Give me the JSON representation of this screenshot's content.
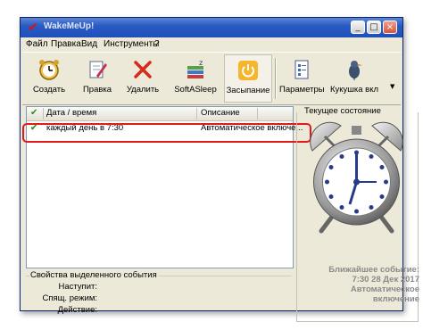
{
  "window": {
    "title": "WakeMeUp!"
  },
  "titlebar_buttons": {
    "minimize": "_",
    "maximize": "□",
    "close": "×"
  },
  "menu": [
    {
      "label": "Файл"
    },
    {
      "label": "Правка"
    },
    {
      "label": "Вид"
    },
    {
      "label": "Инструменты"
    },
    {
      "label": "?"
    }
  ],
  "toolbar": {
    "create": "Создать",
    "edit": "Правка",
    "delete": "Удалить",
    "softasleep": "SoftASleep",
    "sleep": "Засыпание",
    "params": "Параметры",
    "cuckoo": "Кукушка вкл"
  },
  "list": {
    "col_datetime": "Дата / время",
    "col_description": "Описание",
    "rows": [
      {
        "datetime": "каждый день в 7:30",
        "description": "Автоматическое включе..."
      }
    ]
  },
  "props": {
    "title": "Свойства выделенного события",
    "occurs_label": "Наступит:",
    "sleep_mode_label": "Спящ. режим:",
    "action_label": "Действие:"
  },
  "state": {
    "title": "Текущее состояние",
    "clock_time": "7:30",
    "next_label": "Ближайшее событие:",
    "next_time": "7:30 28 Дек 2017",
    "next_desc_1": "Автоматическое",
    "next_desc_2": "включение"
  },
  "colors": {
    "highlight": "#e31a1a",
    "titlebar": "#2a5bc4",
    "window_bg": "#ece9d8"
  }
}
